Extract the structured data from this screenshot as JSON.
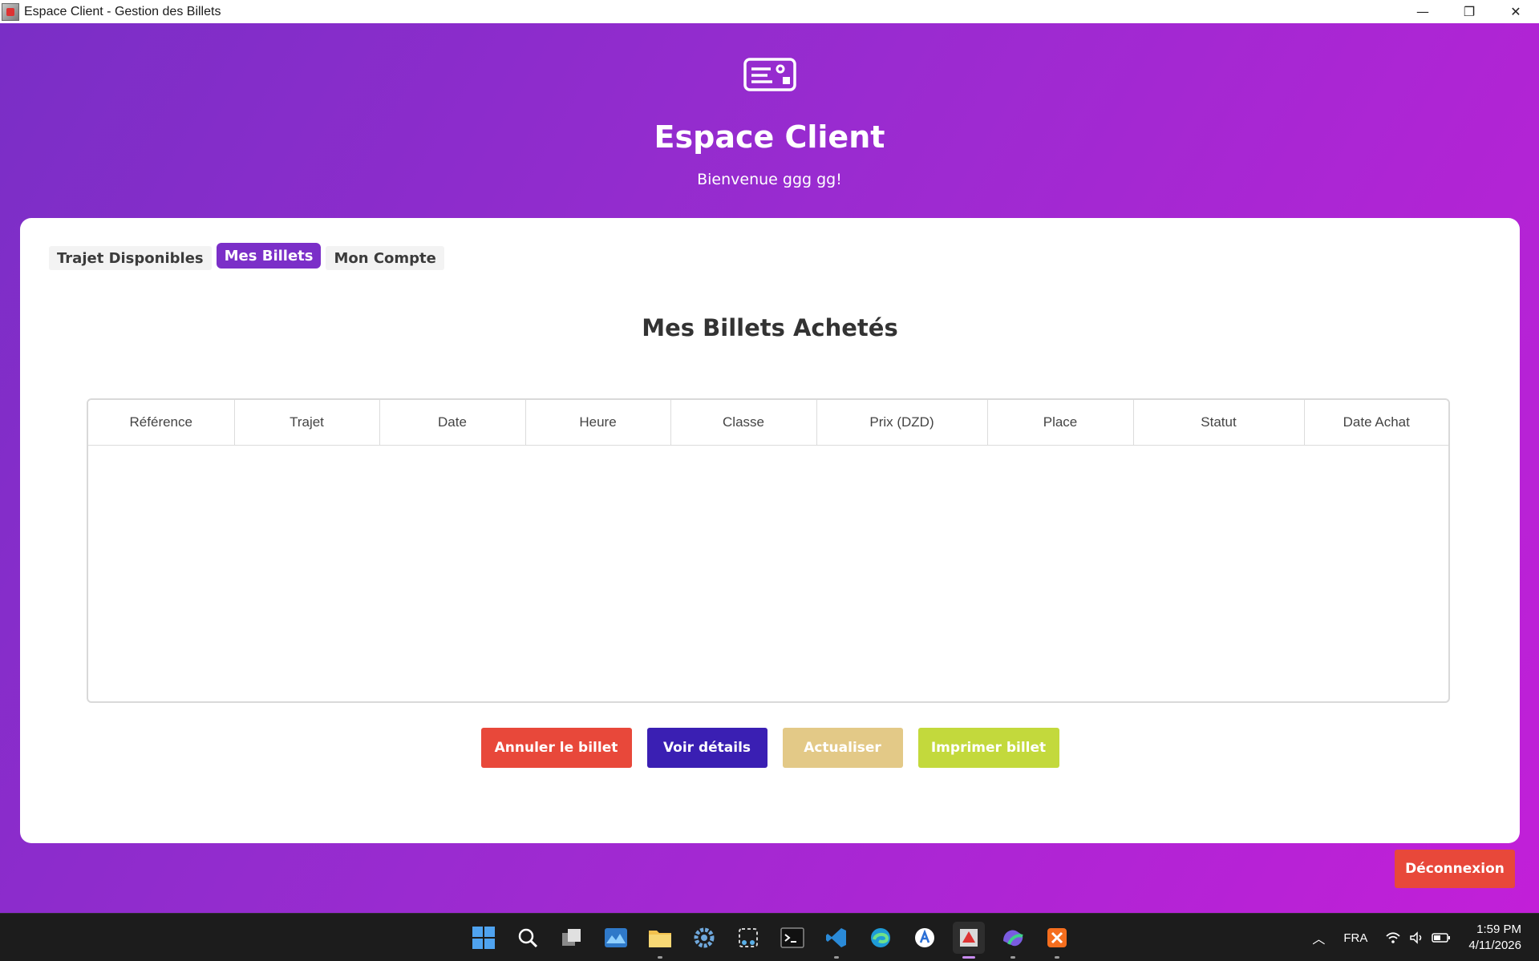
{
  "window": {
    "title": "Espace Client - Gestion des Billets",
    "minimize_glyph": "—",
    "maximize_glyph": "❐",
    "close_glyph": "✕"
  },
  "header": {
    "icon": "ticket-icon",
    "title": "Espace Client",
    "welcome": "Bienvenue ggg gg!"
  },
  "tabs": [
    {
      "label": "Trajet Disponibles",
      "active": false
    },
    {
      "label": "Mes Billets",
      "active": true
    },
    {
      "label": "Mon Compte",
      "active": false
    }
  ],
  "section": {
    "title": "Mes Billets Achetés"
  },
  "table": {
    "columns": [
      "Référence",
      "Trajet",
      "Date",
      "Heure",
      "Classe",
      "Prix (DZD)",
      "Place",
      "Statut",
      "Date Achat"
    ],
    "rows": []
  },
  "actions": {
    "cancel": "Annuler le billet",
    "details": "Voir détails",
    "refresh": "Actualiser",
    "print": "Imprimer billet"
  },
  "logout": "Déconnexion",
  "colors": {
    "accent": "#7b2fc8",
    "danger": "#e8483a",
    "primary": "#3a1fb3",
    "refresh": "#e3c987",
    "print": "#c3d93c"
  },
  "taskbar": {
    "apps": [
      "start-icon",
      "search-icon",
      "task-view-icon",
      "widgets-icon",
      "file-explorer-icon",
      "settings-icon",
      "snipping-tool-icon",
      "terminal-icon",
      "vscode-icon",
      "edge-icon",
      "app-store-icon",
      "java-app-icon",
      "m365-icon",
      "xampp-icon"
    ],
    "tray": {
      "language": "FRA",
      "time": "1:59 PM",
      "date": "4/11/2026"
    }
  }
}
